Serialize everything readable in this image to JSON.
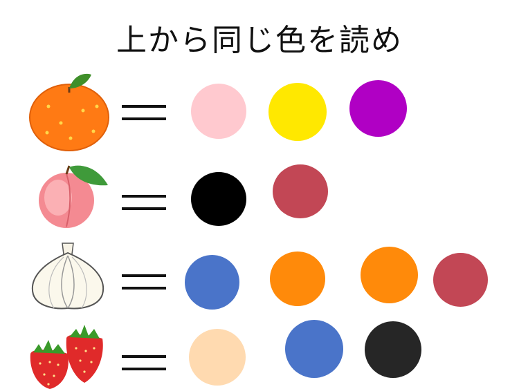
{
  "title": "上から同じ色を読め",
  "colors": {
    "pink": "#ffc9cf",
    "yellow": "#ffe800",
    "purple": "#b000c4",
    "black": "#000000",
    "dusty_red": "#c24755",
    "blue": "#4a74c9",
    "orange": "#ff8a0a",
    "peach": "#ffdab0",
    "dark": "#262626"
  },
  "rows": [
    {
      "fruit": "orange-icon",
      "dots": [
        "pink",
        "yellow",
        "purple"
      ]
    },
    {
      "fruit": "peach-icon",
      "dots": [
        "black",
        "dusty_red"
      ]
    },
    {
      "fruit": "garlic-icon",
      "dots": [
        "blue",
        "orange",
        "orange",
        "dusty_red"
      ]
    },
    {
      "fruit": "strawberry-icon",
      "dots": [
        "peach",
        "blue",
        "dark"
      ]
    }
  ]
}
